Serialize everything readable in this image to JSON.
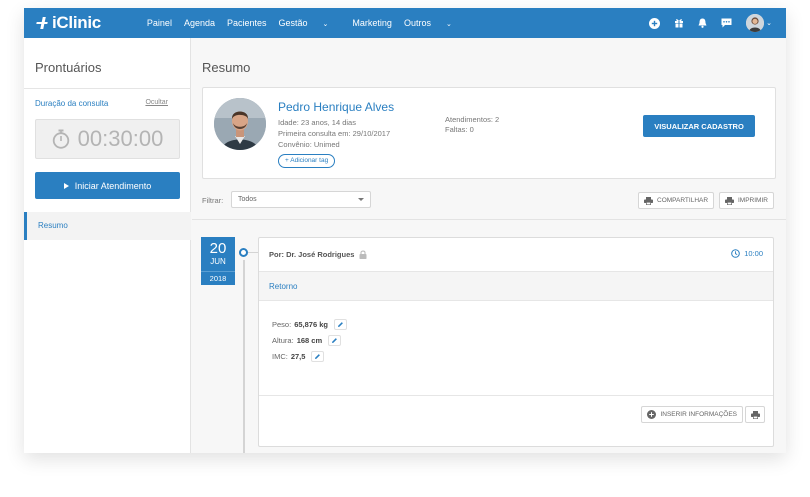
{
  "brand": {
    "name": "iClinic",
    "color": "#2a7fc1"
  },
  "nav": {
    "items": [
      {
        "label": "Painel",
        "caret": false
      },
      {
        "label": "Agenda",
        "caret": false
      },
      {
        "label": "Pacientes",
        "caret": false
      },
      {
        "label": "Gestão",
        "caret": true
      },
      {
        "label": "Marketing",
        "caret": false
      },
      {
        "label": "Outros",
        "caret": true
      }
    ],
    "icons": [
      "add-circle-icon",
      "gift-icon",
      "bell-icon",
      "chat-icon",
      "user-avatar"
    ]
  },
  "sidebar": {
    "title": "Prontuários",
    "duration_label": "Duração da consulta",
    "hide_label": "Ocultar",
    "timer": "00:30:00",
    "start_label": "Iniciar Atendimento",
    "items": [
      {
        "label": "Resumo",
        "active": true
      }
    ]
  },
  "main": {
    "title": "Resumo",
    "patient": {
      "name": "Pedro Henrique Alves",
      "age": "Idade: 23 anos, 14 dias",
      "first_visit": "Primeira consulta em: 29/10/2017",
      "insurance": "Convênio: Unimed",
      "add_tag": "+ Adicionar tag",
      "appointments": "Atendimentos: 2",
      "absences": "Faltas: 0",
      "view_button": "VISUALIZAR CADASTRO"
    },
    "filter": {
      "label": "Filtrar:",
      "value": "Todos",
      "share": "COMPARTILHAR",
      "print": "IMPRIMIR"
    },
    "timeline": {
      "day": "20",
      "month": "JUN",
      "year": "2018",
      "record": {
        "author": "Por: Dr. José Rodrigues",
        "time": "10:00",
        "type": "Retorno",
        "vitals": [
          {
            "label": "Peso:",
            "value": "65,876 kg"
          },
          {
            "label": "Altura:",
            "value": "168 cm"
          },
          {
            "label": "IMC:",
            "value": "27,5"
          }
        ],
        "insert_label": "INSERIR INFORMAÇÕES"
      }
    }
  }
}
